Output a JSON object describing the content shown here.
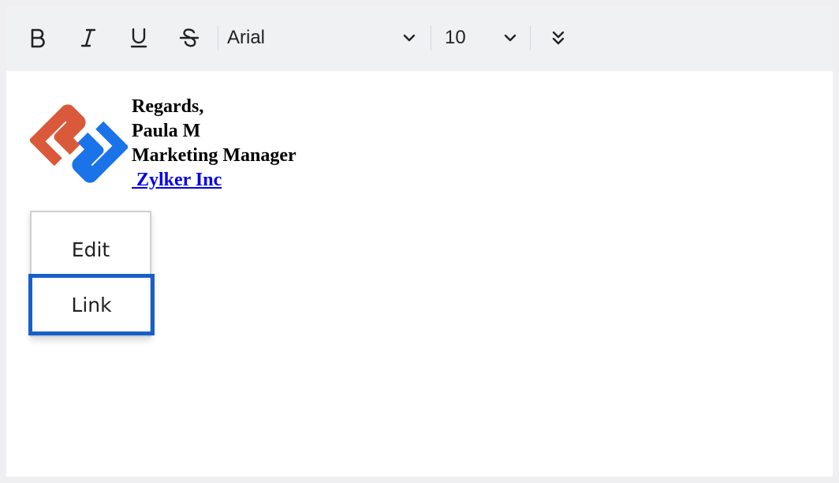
{
  "toolbar": {
    "bold_icon": "bold-icon",
    "italic_icon": "italic-icon",
    "underline_icon": "underline-icon",
    "strikethrough_icon": "strikethrough-icon",
    "font_family": "Arial",
    "font_size": "10",
    "more_icon": "double-chevron-down-icon"
  },
  "signature": {
    "line1": "Regards,",
    "line2": "Paula M",
    "line3": "Marketing Manager",
    "link_text": " Zylker Inc"
  },
  "context_menu": {
    "items": [
      {
        "label": "Edit"
      },
      {
        "label": "Link",
        "highlighted": true
      }
    ]
  },
  "colors": {
    "logo_orange": "#d9593a",
    "logo_blue": "#1a73e8",
    "highlight_border": "#1760c8",
    "link": "#0000ee"
  }
}
